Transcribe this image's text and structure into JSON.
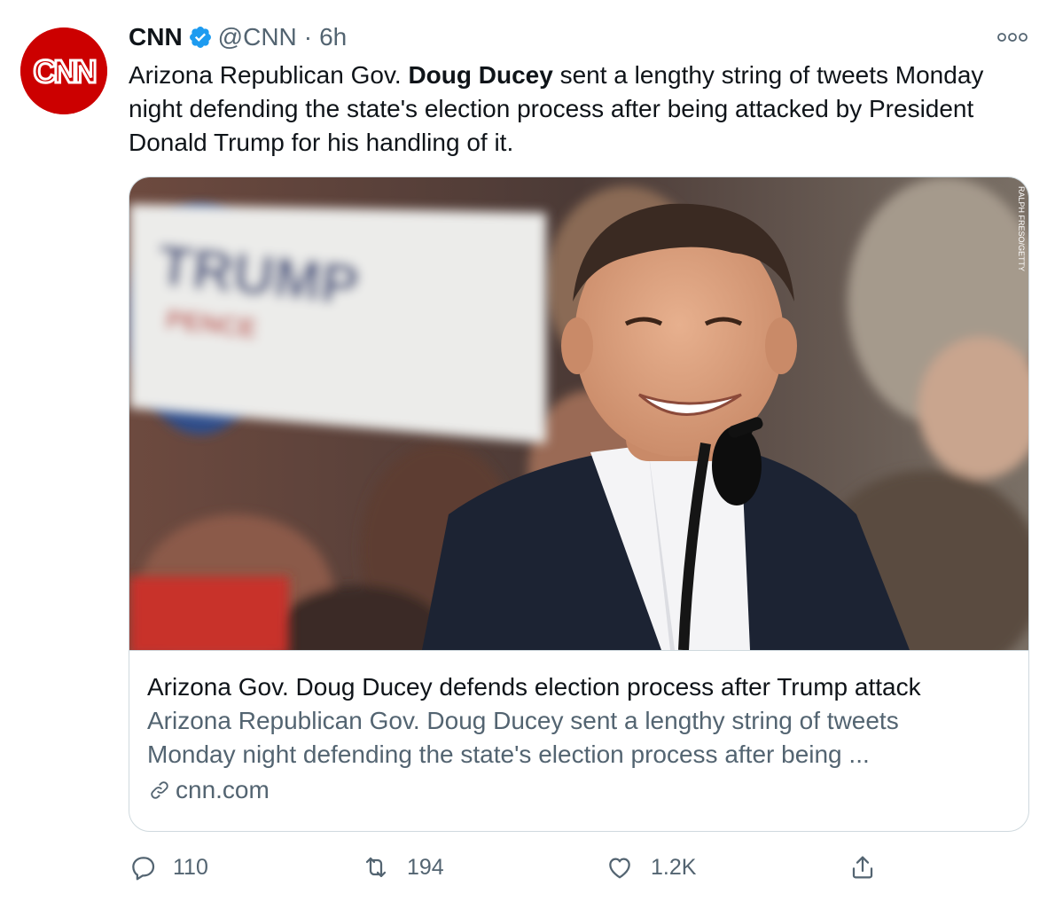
{
  "tweet": {
    "display_name": "CNN",
    "handle": "@CNN",
    "separator": "·",
    "time": "6h",
    "avatar_text": "CNN",
    "text_before": "Arizona Republican Gov. ",
    "text_bold": "Doug Ducey",
    "text_after": " sent a lengthy string of tweets Monday night defending the state's election process after being attacked by President Donald Trump for his handling of it."
  },
  "card": {
    "image_sign_text": "TRUMP",
    "image_sign_subtext": "PENCE",
    "image_credit": "RALPH FRESO/GETTY",
    "title": "Arizona Gov. Doug Ducey defends election process after Trump attack",
    "description_line1": "Arizona Republican Gov. Doug Ducey sent a lengthy string of tweets",
    "description_line2": "Monday night defending the state's election process after being ...",
    "domain": "cnn.com"
  },
  "actions": {
    "reply_count": "110",
    "retweet_count": "194",
    "like_count": "1.2K"
  },
  "colors": {
    "text_primary": "#0f1419",
    "text_secondary": "#536471",
    "verified_blue": "#1d9bf0",
    "cnn_red": "#cc0000",
    "border": "#cfd9de"
  },
  "icons": [
    "more-icon",
    "verified-badge-icon",
    "link-icon",
    "reply-icon",
    "retweet-icon",
    "like-icon",
    "share-icon"
  ]
}
